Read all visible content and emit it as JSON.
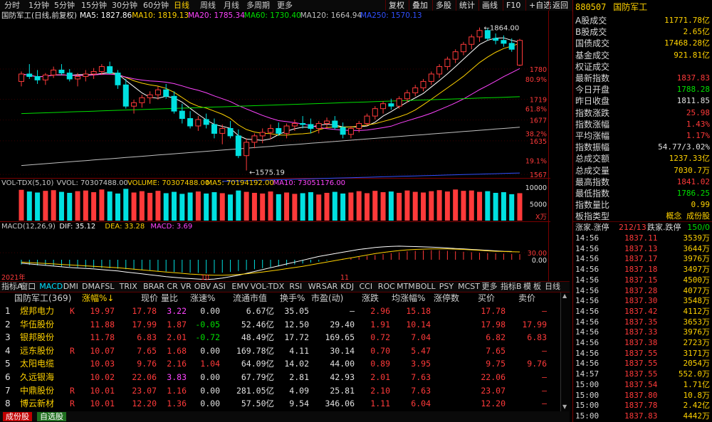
{
  "toolbar": {
    "tabs": [
      "分时",
      "1分钟",
      "5分钟",
      "15分钟",
      "30分钟",
      "60分钟",
      "日线",
      "周线",
      "月线",
      "多周期",
      "更多"
    ],
    "active_tab": "日线",
    "right_buttons": [
      "复权",
      "叠加",
      "多股",
      "统计",
      "画线",
      "F10",
      "+自选",
      "返回"
    ]
  },
  "main_chart": {
    "title": "国防军工(日线,前复权)",
    "ma_legend": [
      {
        "label": "MA5: 1827.86",
        "color": "#ffffff"
      },
      {
        "label": "MA10: 1819.13",
        "color": "#ffd200"
      },
      {
        "label": "MA20: 1785.34",
        "color": "#ff44ff"
      },
      {
        "label": "MA60: 1730.40",
        "color": "#00e000"
      },
      {
        "label": "MA120: 1664.94",
        "color": "#c0c0c0"
      },
      {
        "label": "MA250: 1570.13",
        "color": "#3050ff"
      }
    ],
    "price_axis": [
      "1780",
      "1719",
      "1677",
      "1635",
      "1567"
    ],
    "pct_axis": [
      "80.9%",
      "61.8%",
      "38.2%",
      "19.1%"
    ],
    "high_label": "1864.00",
    "low_label": "1575.19"
  },
  "volume_panel": {
    "legend": [
      {
        "label": "VOL-TDX(5,10)",
        "color": "#c8c8c8"
      },
      {
        "label": "VVOL: 70307488.00",
        "color": "#c8c8c8"
      },
      {
        "label": "VOLUME: 70307488.00",
        "color": "#ffd200"
      },
      {
        "label": "MA5: 70194192.00",
        "color": "#ffd200"
      },
      {
        "label": "MA10: 73051176.00",
        "color": "#ff44ff"
      }
    ],
    "axis": [
      "10000",
      "5000"
    ],
    "unit": "X万"
  },
  "macd_panel": {
    "legend": [
      {
        "label": "MACD(12,26,9)",
        "color": "#c8c8c8"
      },
      {
        "label": "DIF: 35.12",
        "color": "#ffffff"
      },
      {
        "label": "DEA: 33.28",
        "color": "#ffd200"
      },
      {
        "label": "MACD: 3.69",
        "color": "#ff44ff"
      }
    ],
    "axis": [
      "30.00",
      "0.00"
    ]
  },
  "date_axis": [
    "2021年",
    "10",
    "11"
  ],
  "right_panel": {
    "code": "880507",
    "name": "国防军工",
    "stats": [
      {
        "k": "A股成交",
        "v": "11771.78亿",
        "c": "#ffd200"
      },
      {
        "k": "B股成交",
        "v": "2.65亿",
        "c": "#ffd200"
      },
      {
        "k": "国债成交",
        "v": "17468.28亿",
        "c": "#ffd200"
      },
      {
        "k": "基金成交",
        "v": "921.81亿",
        "c": "#ffd200"
      },
      {
        "k": "权证成交",
        "v": "",
        "c": "#ffd200"
      },
      {
        "k": "最新指数",
        "v": "1837.83",
        "c": "#ff3a3a"
      },
      {
        "k": "今日开盘",
        "v": "1788.28",
        "c": "#00e000"
      },
      {
        "k": "昨日收盘",
        "v": "1811.85",
        "c": "#e0e0e0"
      },
      {
        "k": "指数涨跌",
        "v": "25.98",
        "c": "#ff3a3a"
      },
      {
        "k": "指数涨幅",
        "v": "1.43%",
        "c": "#ff3a3a"
      },
      {
        "k": "平均涨幅",
        "v": "1.17%",
        "c": "#ff3a3a"
      },
      {
        "k": "指数振幅",
        "v": "54.77/3.02%",
        "c": "#e0e0e0"
      },
      {
        "k": "总成交额",
        "v": "1237.33亿",
        "c": "#ffd200"
      },
      {
        "k": "总成交量",
        "v": "7030.7万",
        "c": "#ffd200"
      },
      {
        "k": "最高指数",
        "v": "1841.02",
        "c": "#ff3a3a"
      },
      {
        "k": "最低指数",
        "v": "1786.25",
        "c": "#00e000"
      },
      {
        "k": "指数量比",
        "v": "0.99",
        "c": "#ffd200"
      },
      {
        "k": "板指类型",
        "v": "概念 成份股",
        "c": "#ffd200"
      }
    ],
    "updown_label": "涨家.涨停",
    "updown_value": "212/13",
    "down_label": "跌家.跌停",
    "down_value": "150/0",
    "ticks": [
      {
        "t": "14:56",
        "p": "1837.11",
        "q": "3539万"
      },
      {
        "t": "14:56",
        "p": "1837.13",
        "q": "3644万"
      },
      {
        "t": "14:56",
        "p": "1837.17",
        "q": "3976万"
      },
      {
        "t": "14:56",
        "p": "1837.18",
        "q": "3497万"
      },
      {
        "t": "14:56",
        "p": "1837.15",
        "q": "4500万"
      },
      {
        "t": "14:56",
        "p": "1837.28",
        "q": "4077万"
      },
      {
        "t": "14:56",
        "p": "1837.30",
        "q": "3548万"
      },
      {
        "t": "14:56",
        "p": "1837.42",
        "q": "4112万"
      },
      {
        "t": "14:56",
        "p": "1837.35",
        "q": "3653万"
      },
      {
        "t": "14:56",
        "p": "1837.33",
        "q": "3976万"
      },
      {
        "t": "14:56",
        "p": "1837.38",
        "q": "2723万"
      },
      {
        "t": "14:56",
        "p": "1837.55",
        "q": "3171万"
      },
      {
        "t": "14:56",
        "p": "1837.55",
        "q": "2054万"
      },
      {
        "t": "14:57",
        "p": "1837.55",
        "q": "552.0万"
      },
      {
        "t": "15:00",
        "p": "1837.54",
        "q": "1.71亿"
      },
      {
        "t": "15:00",
        "p": "1837.80",
        "q": "10.8万"
      },
      {
        "t": "15:00",
        "p": "1837.78",
        "q": "2.42亿"
      },
      {
        "t": "15:00",
        "p": "1837.83",
        "q": "4442万"
      }
    ]
  },
  "tab_bar": {
    "items": [
      "指标A",
      "窗口",
      "MACD",
      "DMI",
      "DMA",
      "FSL",
      "TRIX",
      "BRAR",
      "CR",
      "VR",
      "OBV",
      "ASI",
      "EMV",
      "VOL-TDX",
      "RSI",
      "WR",
      "SAR",
      "KDJ",
      "CCI",
      "ROC",
      "MTM",
      "BOLL",
      "PSY",
      "MCST",
      "更多"
    ],
    "active": "MACD",
    "right_items": [
      "指标B",
      "模",
      "板",
      "日线"
    ]
  },
  "table": {
    "headers": [
      "国防军工(369)",
      "涨幅%↓",
      "现价",
      "量比",
      "涨速%",
      "流通市值",
      "换手%",
      "市盈(动)",
      "涨跌",
      "均涨幅%",
      "涨停数",
      "买价",
      "卖价"
    ],
    "rows": [
      {
        "n": "1",
        "name": "煜邦电力",
        "flag": "K",
        "chg": "19.97",
        "price": "17.78",
        "vr": "3.22",
        "spd": "0.00",
        "cap": "6.67亿",
        "turn": "35.05",
        "pe": "–",
        "diff": "2.96",
        "avg": "15.18",
        "lim": "",
        "bid": "17.78",
        "ask": "–"
      },
      {
        "n": "2",
        "name": "华伍股份",
        "flag": "",
        "chg": "11.88",
        "price": "17.99",
        "vr": "1.87",
        "spd": "-0.05",
        "cap": "52.46亿",
        "turn": "12.50",
        "pe": "29.40",
        "diff": "1.91",
        "avg": "10.14",
        "lim": "",
        "bid": "17.98",
        "ask": "17.99"
      },
      {
        "n": "3",
        "name": "银邦股份",
        "flag": "",
        "chg": "11.78",
        "price": "6.83",
        "vr": "2.01",
        "spd": "-0.72",
        "cap": "48.49亿",
        "turn": "17.72",
        "pe": "169.65",
        "diff": "0.72",
        "avg": "7.04",
        "lim": "",
        "bid": "6.82",
        "ask": "6.83"
      },
      {
        "n": "4",
        "name": "远东股份",
        "flag": "R",
        "chg": "10.07",
        "price": "7.65",
        "vr": "1.68",
        "spd": "0.00",
        "cap": "169.78亿",
        "turn": "4.11",
        "pe": "30.14",
        "diff": "0.70",
        "avg": "5.47",
        "lim": "",
        "bid": "7.65",
        "ask": "–"
      },
      {
        "n": "5",
        "name": "太阳电缆",
        "flag": "",
        "chg": "10.03",
        "price": "9.76",
        "vr": "2.16",
        "spd": "1.04",
        "cap": "64.09亿",
        "turn": "14.02",
        "pe": "44.00",
        "diff": "0.89",
        "avg": "3.95",
        "lim": "",
        "bid": "9.75",
        "ask": "9.76"
      },
      {
        "n": "6",
        "name": "久远银海",
        "flag": "",
        "chg": "10.02",
        "price": "22.06",
        "vr": "3.83",
        "spd": "0.00",
        "cap": "67.79亿",
        "turn": "2.81",
        "pe": "42.93",
        "diff": "2.01",
        "avg": "7.63",
        "lim": "",
        "bid": "22.06",
        "ask": "–"
      },
      {
        "n": "7",
        "name": "中鼎股份",
        "flag": "R",
        "chg": "10.01",
        "price": "23.07",
        "vr": "1.16",
        "spd": "0.00",
        "cap": "281.05亿",
        "turn": "4.09",
        "pe": "25.81",
        "diff": "2.10",
        "avg": "7.63",
        "lim": "",
        "bid": "23.07",
        "ask": "–"
      },
      {
        "n": "8",
        "name": "博云新材",
        "flag": "R",
        "chg": "10.01",
        "price": "12.20",
        "vr": "1.36",
        "spd": "0.00",
        "cap": "57.50亿",
        "turn": "9.54",
        "pe": "346.06",
        "diff": "1.11",
        "avg": "6.04",
        "lim": "",
        "bid": "12.20",
        "ask": "–"
      }
    ]
  },
  "bottom_bar": {
    "items": [
      "成份股",
      "自选股"
    ]
  },
  "chart_data": {
    "type": "candlestick",
    "ohlc": [
      [
        1755,
        1775,
        1745,
        1770
      ],
      [
        1770,
        1790,
        1760,
        1765
      ],
      [
        1765,
        1778,
        1750,
        1758
      ],
      [
        1758,
        1772,
        1748,
        1768
      ],
      [
        1768,
        1785,
        1762,
        1778
      ],
      [
        1778,
        1790,
        1768,
        1772
      ],
      [
        1772,
        1780,
        1755,
        1760
      ],
      [
        1760,
        1772,
        1745,
        1765
      ],
      [
        1765,
        1778,
        1755,
        1770
      ],
      [
        1770,
        1782,
        1760,
        1775
      ],
      [
        1775,
        1790,
        1768,
        1785
      ],
      [
        1785,
        1795,
        1770,
        1772
      ],
      [
        1772,
        1778,
        1740,
        1748
      ],
      [
        1748,
        1760,
        1700,
        1705
      ],
      [
        1705,
        1718,
        1690,
        1712
      ],
      [
        1712,
        1728,
        1702,
        1722
      ],
      [
        1722,
        1735,
        1710,
        1728
      ],
      [
        1728,
        1745,
        1718,
        1738
      ],
      [
        1738,
        1750,
        1720,
        1725
      ],
      [
        1725,
        1735,
        1690,
        1695
      ],
      [
        1695,
        1710,
        1670,
        1680
      ],
      [
        1680,
        1695,
        1660,
        1665
      ],
      [
        1665,
        1685,
        1655,
        1678
      ],
      [
        1678,
        1690,
        1660,
        1668
      ],
      [
        1668,
        1680,
        1640,
        1650
      ],
      [
        1650,
        1668,
        1628,
        1660
      ],
      [
        1660,
        1675,
        1640,
        1645
      ],
      [
        1645,
        1658,
        1600,
        1605
      ],
      [
        1605,
        1640,
        1575,
        1632
      ],
      [
        1632,
        1650,
        1620,
        1645
      ],
      [
        1645,
        1660,
        1630,
        1652
      ],
      [
        1652,
        1668,
        1638,
        1660
      ],
      [
        1660,
        1672,
        1645,
        1650
      ],
      [
        1650,
        1670,
        1640,
        1665
      ],
      [
        1665,
        1678,
        1655,
        1670
      ],
      [
        1670,
        1685,
        1660,
        1668
      ],
      [
        1668,
        1680,
        1650,
        1660
      ],
      [
        1660,
        1675,
        1650,
        1670
      ],
      [
        1670,
        1682,
        1660,
        1675
      ],
      [
        1675,
        1685,
        1658,
        1662
      ],
      [
        1662,
        1672,
        1640,
        1648
      ],
      [
        1648,
        1665,
        1640,
        1660
      ],
      [
        1660,
        1675,
        1652,
        1670
      ],
      [
        1670,
        1690,
        1665,
        1685
      ],
      [
        1685,
        1705,
        1678,
        1700
      ],
      [
        1700,
        1715,
        1690,
        1710
      ],
      [
        1710,
        1720,
        1698,
        1705
      ],
      [
        1705,
        1725,
        1700,
        1720
      ],
      [
        1720,
        1738,
        1712,
        1732
      ],
      [
        1732,
        1748,
        1725,
        1742
      ],
      [
        1742,
        1760,
        1735,
        1755
      ],
      [
        1755,
        1775,
        1748,
        1770
      ],
      [
        1770,
        1790,
        1762,
        1785
      ],
      [
        1785,
        1805,
        1778,
        1800
      ],
      [
        1800,
        1820,
        1792,
        1815
      ],
      [
        1815,
        1835,
        1808,
        1830
      ],
      [
        1830,
        1850,
        1820,
        1845
      ],
      [
        1845,
        1864,
        1835,
        1858
      ],
      [
        1858,
        1862,
        1838,
        1842
      ],
      [
        1842,
        1852,
        1830,
        1838
      ],
      [
        1838,
        1848,
        1825,
        1832
      ],
      [
        1832,
        1842,
        1815,
        1820
      ],
      [
        1788,
        1841,
        1786,
        1838
      ]
    ],
    "volume": [
      9200,
      8700,
      8400,
      8900,
      9100,
      8600,
      8300,
      8800,
      9000,
      8500,
      9300,
      8700,
      8100,
      9500,
      8400,
      8800,
      8300,
      8900,
      8200,
      8600,
      8000,
      8400,
      8700,
      8100,
      8500,
      8200,
      7800,
      9000,
      8600,
      8300,
      8100,
      8700,
      7900,
      8400,
      8000,
      8200,
      8500,
      7800,
      8300,
      8600,
      8100,
      8400,
      8800,
      8200,
      8900,
      8500,
      8700,
      8300,
      9000,
      8600,
      8400,
      8800,
      9100,
      8700,
      9300,
      8900,
      9000,
      8600,
      8800,
      8300,
      8500,
      7900,
      8200
    ],
    "macd": [
      -20,
      -22,
      -24,
      -25,
      -26,
      -28,
      -30,
      -32,
      -33,
      -34,
      -35,
      -36,
      -38,
      -40,
      -42,
      -44,
      -46,
      -48,
      -50,
      -52,
      -54,
      -55,
      -56,
      -58,
      -57,
      -55,
      -52,
      -48,
      -44,
      -40,
      -36,
      -32,
      -28,
      -24,
      -20,
      -16,
      -12,
      -8,
      -4,
      0,
      4,
      8,
      12,
      16,
      20,
      24,
      28,
      32,
      36,
      38,
      40,
      41,
      40,
      38,
      36,
      34,
      32,
      30,
      28,
      27,
      26,
      25,
      24
    ],
    "dif": [
      -15,
      -18,
      -21,
      -24,
      -27,
      -30,
      -33,
      -35,
      -37,
      -39,
      -42,
      -45,
      -48,
      -52,
      -56,
      -60,
      -64,
      -68,
      -72,
      -75,
      -78,
      -80,
      -82,
      -84,
      -82,
      -78,
      -72,
      -66,
      -58,
      -50,
      -42,
      -34,
      -26,
      -18,
      -10,
      -2,
      6,
      14,
      20,
      26,
      32,
      38,
      44,
      48,
      52,
      55,
      57,
      58,
      57,
      56,
      55,
      54,
      52,
      50,
      48,
      46,
      44,
      42,
      40,
      38,
      36,
      35.12
    ],
    "dea": [
      -10,
      -12,
      -14,
      -16,
      -18,
      -20,
      -22,
      -24,
      -26,
      -28,
      -30,
      -32,
      -34,
      -37,
      -40,
      -43,
      -46,
      -49,
      -52,
      -55,
      -58,
      -61,
      -63,
      -65,
      -66,
      -66,
      -65,
      -63,
      -60,
      -56,
      -52,
      -48,
      -43,
      -38,
      -33,
      -28,
      -22,
      -16,
      -10,
      -4,
      2,
      8,
      14,
      20,
      26,
      31,
      35,
      39,
      42,
      44,
      45,
      46,
      46,
      46,
      45,
      44,
      42,
      40,
      38,
      36,
      35,
      34,
      33.28
    ],
    "ylim": [
      1560,
      1875
    ]
  }
}
